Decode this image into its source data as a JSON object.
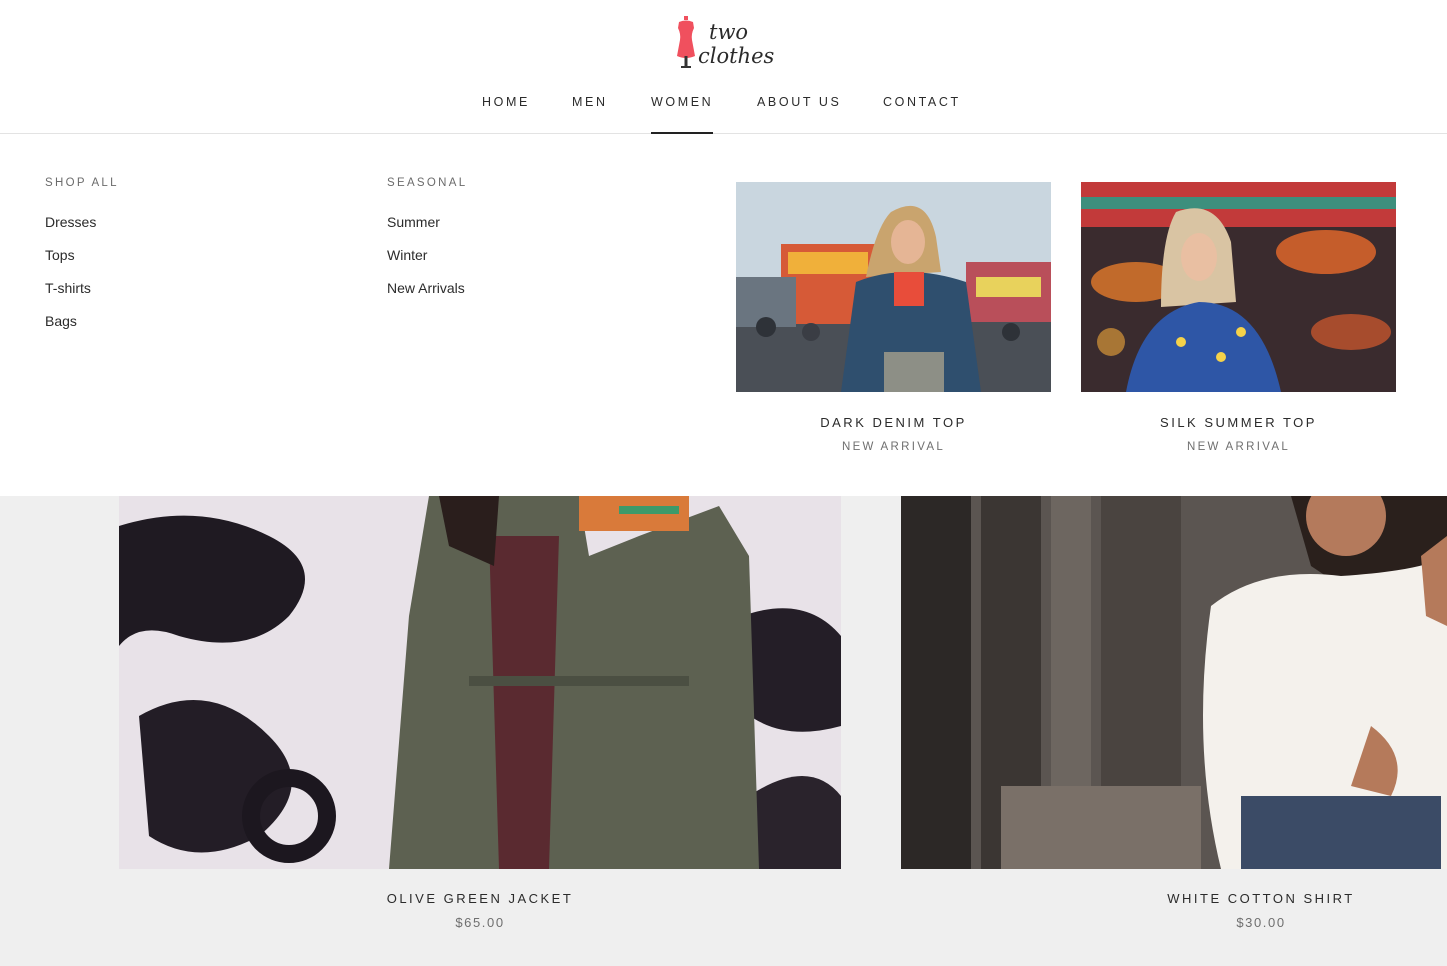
{
  "brand": {
    "line1": "two",
    "line2": "clothes",
    "icon": "dress-form-icon",
    "accent": "#f0505e"
  },
  "nav": {
    "items": [
      {
        "label": "HOME"
      },
      {
        "label": "MEN"
      },
      {
        "label": "WOMEN",
        "active": true
      },
      {
        "label": "ABOUT US"
      },
      {
        "label": "CONTACT"
      }
    ]
  },
  "mega_menu": {
    "columns": [
      {
        "title": "SHOP ALL",
        "links": [
          "Dresses",
          "Tops",
          "T-shirts",
          "Bags"
        ]
      },
      {
        "title": "SEASONAL",
        "links": [
          "Summer",
          "Winter",
          "New Arrivals"
        ]
      }
    ],
    "promos": [
      {
        "title": "DARK DENIM TOP",
        "subtitle": "NEW ARRIVAL"
      },
      {
        "title": "SILK SUMMER TOP",
        "subtitle": "NEW ARRIVAL"
      }
    ]
  },
  "products": [
    {
      "title": "OLIVE GREEN JACKET",
      "price": "$65.00"
    },
    {
      "title": "WHITE COTTON SHIRT",
      "price": "$30.00"
    }
  ]
}
